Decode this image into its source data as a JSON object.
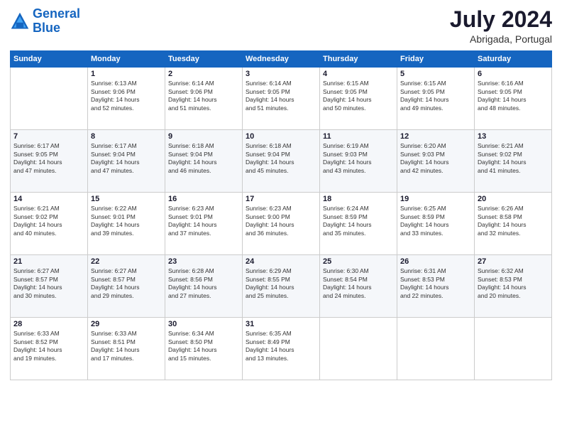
{
  "header": {
    "logo_line1": "General",
    "logo_line2": "Blue",
    "month_year": "July 2024",
    "location": "Abrigada, Portugal"
  },
  "weekdays": [
    "Sunday",
    "Monday",
    "Tuesday",
    "Wednesday",
    "Thursday",
    "Friday",
    "Saturday"
  ],
  "weeks": [
    [
      {
        "day": "",
        "sunrise": "",
        "sunset": "",
        "daylight": ""
      },
      {
        "day": "1",
        "sunrise": "Sunrise: 6:13 AM",
        "sunset": "Sunset: 9:06 PM",
        "daylight": "Daylight: 14 hours and 52 minutes."
      },
      {
        "day": "2",
        "sunrise": "Sunrise: 6:14 AM",
        "sunset": "Sunset: 9:06 PM",
        "daylight": "Daylight: 14 hours and 51 minutes."
      },
      {
        "day": "3",
        "sunrise": "Sunrise: 6:14 AM",
        "sunset": "Sunset: 9:05 PM",
        "daylight": "Daylight: 14 hours and 51 minutes."
      },
      {
        "day": "4",
        "sunrise": "Sunrise: 6:15 AM",
        "sunset": "Sunset: 9:05 PM",
        "daylight": "Daylight: 14 hours and 50 minutes."
      },
      {
        "day": "5",
        "sunrise": "Sunrise: 6:15 AM",
        "sunset": "Sunset: 9:05 PM",
        "daylight": "Daylight: 14 hours and 49 minutes."
      },
      {
        "day": "6",
        "sunrise": "Sunrise: 6:16 AM",
        "sunset": "Sunset: 9:05 PM",
        "daylight": "Daylight: 14 hours and 48 minutes."
      }
    ],
    [
      {
        "day": "7",
        "sunrise": "Sunrise: 6:17 AM",
        "sunset": "Sunset: 9:05 PM",
        "daylight": "Daylight: 14 hours and 47 minutes."
      },
      {
        "day": "8",
        "sunrise": "Sunrise: 6:17 AM",
        "sunset": "Sunset: 9:04 PM",
        "daylight": "Daylight: 14 hours and 47 minutes."
      },
      {
        "day": "9",
        "sunrise": "Sunrise: 6:18 AM",
        "sunset": "Sunset: 9:04 PM",
        "daylight": "Daylight: 14 hours and 46 minutes."
      },
      {
        "day": "10",
        "sunrise": "Sunrise: 6:18 AM",
        "sunset": "Sunset: 9:04 PM",
        "daylight": "Daylight: 14 hours and 45 minutes."
      },
      {
        "day": "11",
        "sunrise": "Sunrise: 6:19 AM",
        "sunset": "Sunset: 9:03 PM",
        "daylight": "Daylight: 14 hours and 43 minutes."
      },
      {
        "day": "12",
        "sunrise": "Sunrise: 6:20 AM",
        "sunset": "Sunset: 9:03 PM",
        "daylight": "Daylight: 14 hours and 42 minutes."
      },
      {
        "day": "13",
        "sunrise": "Sunrise: 6:21 AM",
        "sunset": "Sunset: 9:02 PM",
        "daylight": "Daylight: 14 hours and 41 minutes."
      }
    ],
    [
      {
        "day": "14",
        "sunrise": "Sunrise: 6:21 AM",
        "sunset": "Sunset: 9:02 PM",
        "daylight": "Daylight: 14 hours and 40 minutes."
      },
      {
        "day": "15",
        "sunrise": "Sunrise: 6:22 AM",
        "sunset": "Sunset: 9:01 PM",
        "daylight": "Daylight: 14 hours and 39 minutes."
      },
      {
        "day": "16",
        "sunrise": "Sunrise: 6:23 AM",
        "sunset": "Sunset: 9:01 PM",
        "daylight": "Daylight: 14 hours and 37 minutes."
      },
      {
        "day": "17",
        "sunrise": "Sunrise: 6:23 AM",
        "sunset": "Sunset: 9:00 PM",
        "daylight": "Daylight: 14 hours and 36 minutes."
      },
      {
        "day": "18",
        "sunrise": "Sunrise: 6:24 AM",
        "sunset": "Sunset: 8:59 PM",
        "daylight": "Daylight: 14 hours and 35 minutes."
      },
      {
        "day": "19",
        "sunrise": "Sunrise: 6:25 AM",
        "sunset": "Sunset: 8:59 PM",
        "daylight": "Daylight: 14 hours and 33 minutes."
      },
      {
        "day": "20",
        "sunrise": "Sunrise: 6:26 AM",
        "sunset": "Sunset: 8:58 PM",
        "daylight": "Daylight: 14 hours and 32 minutes."
      }
    ],
    [
      {
        "day": "21",
        "sunrise": "Sunrise: 6:27 AM",
        "sunset": "Sunset: 8:57 PM",
        "daylight": "Daylight: 14 hours and 30 minutes."
      },
      {
        "day": "22",
        "sunrise": "Sunrise: 6:27 AM",
        "sunset": "Sunset: 8:57 PM",
        "daylight": "Daylight: 14 hours and 29 minutes."
      },
      {
        "day": "23",
        "sunrise": "Sunrise: 6:28 AM",
        "sunset": "Sunset: 8:56 PM",
        "daylight": "Daylight: 14 hours and 27 minutes."
      },
      {
        "day": "24",
        "sunrise": "Sunrise: 6:29 AM",
        "sunset": "Sunset: 8:55 PM",
        "daylight": "Daylight: 14 hours and 25 minutes."
      },
      {
        "day": "25",
        "sunrise": "Sunrise: 6:30 AM",
        "sunset": "Sunset: 8:54 PM",
        "daylight": "Daylight: 14 hours and 24 minutes."
      },
      {
        "day": "26",
        "sunrise": "Sunrise: 6:31 AM",
        "sunset": "Sunset: 8:53 PM",
        "daylight": "Daylight: 14 hours and 22 minutes."
      },
      {
        "day": "27",
        "sunrise": "Sunrise: 6:32 AM",
        "sunset": "Sunset: 8:53 PM",
        "daylight": "Daylight: 14 hours and 20 minutes."
      }
    ],
    [
      {
        "day": "28",
        "sunrise": "Sunrise: 6:33 AM",
        "sunset": "Sunset: 8:52 PM",
        "daylight": "Daylight: 14 hours and 19 minutes."
      },
      {
        "day": "29",
        "sunrise": "Sunrise: 6:33 AM",
        "sunset": "Sunset: 8:51 PM",
        "daylight": "Daylight: 14 hours and 17 minutes."
      },
      {
        "day": "30",
        "sunrise": "Sunrise: 6:34 AM",
        "sunset": "Sunset: 8:50 PM",
        "daylight": "Daylight: 14 hours and 15 minutes."
      },
      {
        "day": "31",
        "sunrise": "Sunrise: 6:35 AM",
        "sunset": "Sunset: 8:49 PM",
        "daylight": "Daylight: 14 hours and 13 minutes."
      },
      {
        "day": "",
        "sunrise": "",
        "sunset": "",
        "daylight": ""
      },
      {
        "day": "",
        "sunrise": "",
        "sunset": "",
        "daylight": ""
      },
      {
        "day": "",
        "sunrise": "",
        "sunset": "",
        "daylight": ""
      }
    ]
  ]
}
